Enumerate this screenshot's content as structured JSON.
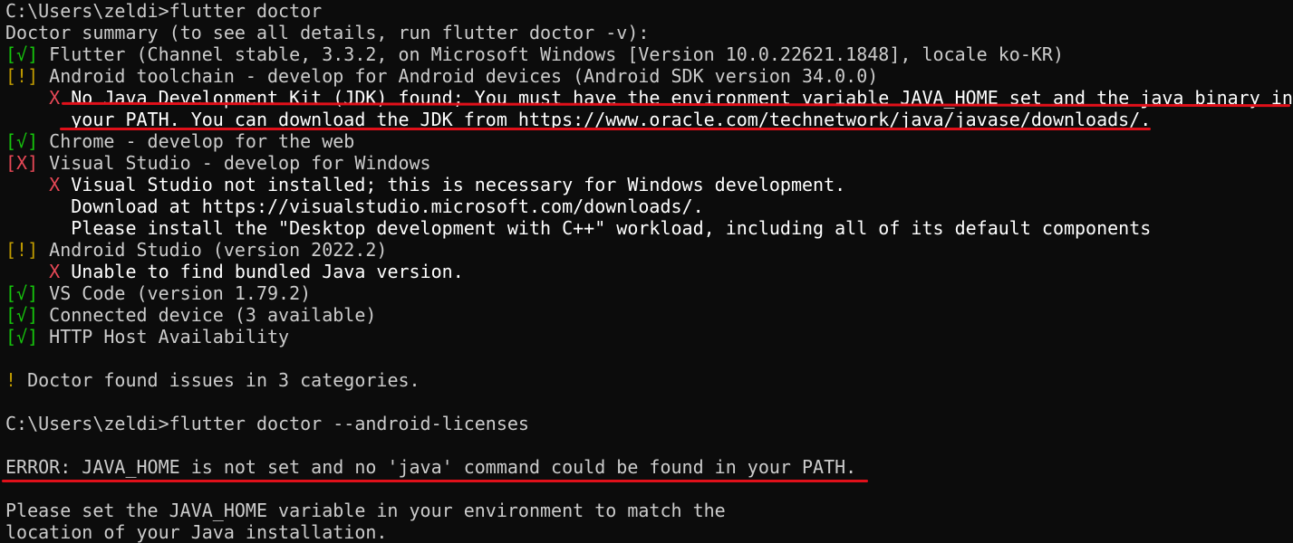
{
  "terminal": {
    "lines": [
      {
        "parts": [
          {
            "text": "C:\\Users\\zeldi>flutter doctor",
            "color": "default"
          }
        ]
      },
      {
        "parts": [
          {
            "text": "Doctor summary (to see all details, run flutter doctor -v):",
            "color": "default"
          }
        ]
      },
      {
        "parts": [
          {
            "text": "[√]",
            "color": "green"
          },
          {
            "text": " Flutter (Channel stable, 3.3.2, on Microsoft Windows [Version 10.0.22621.1848], locale ko-KR)",
            "color": "default"
          }
        ]
      },
      {
        "parts": [
          {
            "text": "[!]",
            "color": "yellow"
          },
          {
            "text": " Android toolchain - develop for Android devices (Android SDK version 34.0.0)",
            "color": "default"
          }
        ]
      },
      {
        "parts": [
          {
            "text": "    X",
            "color": "red"
          },
          {
            "text": " No Java Development Kit (JDK) found; You must have the environment variable JAVA_HOME set and the java binary in",
            "color": "white"
          }
        ]
      },
      {
        "parts": [
          {
            "text": "      your PATH. You can download the JDK from https://www.oracle.com/technetwork/java/javase/downloads/.",
            "color": "white"
          }
        ]
      },
      {
        "parts": [
          {
            "text": "[√]",
            "color": "green"
          },
          {
            "text": " Chrome - develop for the web",
            "color": "default"
          }
        ]
      },
      {
        "parts": [
          {
            "text": "[X]",
            "color": "red"
          },
          {
            "text": " Visual Studio - develop for Windows",
            "color": "default"
          }
        ]
      },
      {
        "parts": [
          {
            "text": "    X",
            "color": "red"
          },
          {
            "text": " Visual Studio not installed; this is necessary for Windows development.",
            "color": "white"
          }
        ]
      },
      {
        "parts": [
          {
            "text": "      Download at https://visualstudio.microsoft.com/downloads/.",
            "color": "white"
          }
        ]
      },
      {
        "parts": [
          {
            "text": "      Please install the \"Desktop development with C++\" workload, including all of its default components",
            "color": "white"
          }
        ]
      },
      {
        "parts": [
          {
            "text": "[!]",
            "color": "yellow"
          },
          {
            "text": " Android Studio (version 2022.2)",
            "color": "default"
          }
        ]
      },
      {
        "parts": [
          {
            "text": "    X",
            "color": "red"
          },
          {
            "text": " Unable to find bundled Java version.",
            "color": "white"
          }
        ]
      },
      {
        "parts": [
          {
            "text": "[√]",
            "color": "green"
          },
          {
            "text": " VS Code (version 1.79.2)",
            "color": "default"
          }
        ]
      },
      {
        "parts": [
          {
            "text": "[√]",
            "color": "green"
          },
          {
            "text": " Connected device (3 available)",
            "color": "default"
          }
        ]
      },
      {
        "parts": [
          {
            "text": "[√]",
            "color": "green"
          },
          {
            "text": " HTTP Host Availability",
            "color": "default"
          }
        ]
      },
      {
        "parts": [
          {
            "text": "",
            "color": "default"
          }
        ]
      },
      {
        "parts": [
          {
            "text": "!",
            "color": "yellow"
          },
          {
            "text": " Doctor found issues in 3 categories.",
            "color": "default"
          }
        ]
      },
      {
        "parts": [
          {
            "text": "",
            "color": "default"
          }
        ]
      },
      {
        "parts": [
          {
            "text": "C:\\Users\\zeldi>flutter doctor --android-licenses",
            "color": "default"
          }
        ]
      },
      {
        "parts": [
          {
            "text": "",
            "color": "default"
          }
        ]
      },
      {
        "parts": [
          {
            "text": "ERROR: JAVA_HOME is not set and no 'java' command could be found in your PATH.",
            "color": "default"
          }
        ]
      },
      {
        "parts": [
          {
            "text": "",
            "color": "default"
          }
        ]
      },
      {
        "parts": [
          {
            "text": "Please set the JAVA_HOME variable in your environment to match the",
            "color": "default"
          }
        ]
      },
      {
        "parts": [
          {
            "text": "location of your Java installation.",
            "color": "default"
          }
        ]
      }
    ]
  },
  "colors": {
    "background": "#0c0c0c",
    "default_text": "#cccccc",
    "bright_text": "#ffffff",
    "green": "#16c60c",
    "yellow": "#c19c00",
    "red": "#e74856",
    "annotation_red": "#e0101a"
  }
}
